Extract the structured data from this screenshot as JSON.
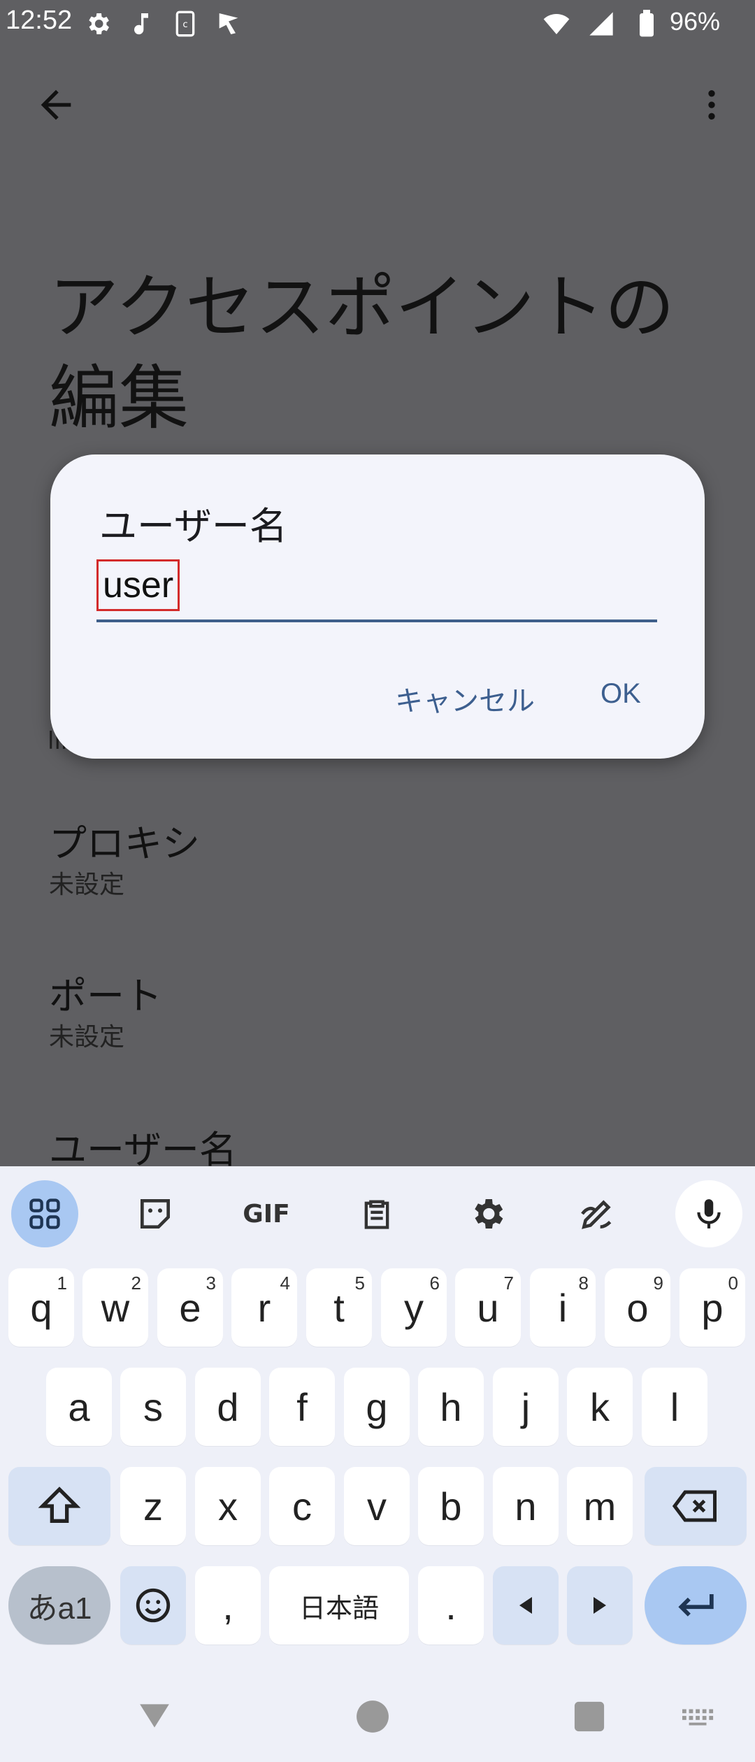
{
  "status_bar": {
    "time": "12:52",
    "battery": "96%"
  },
  "page": {
    "title": "アクセスポイントの編集",
    "title_line1": "アクセスポイントの",
    "title_line2": "編集",
    "prefs": [
      {
        "title": "プロキシ",
        "summary": "未設定"
      },
      {
        "title": "ポート",
        "summary": "未設定"
      },
      {
        "title": "ユーザー名",
        "summary": ""
      }
    ],
    "partial_text": "lii"
  },
  "dialog": {
    "title": "ユーザー名",
    "value": "user",
    "cancel_label": "キャンセル",
    "ok_label": "OK"
  },
  "keyboard": {
    "toolbar": [
      "apps-icon",
      "sticker-icon",
      "gif-icon",
      "clipboard-icon",
      "settings-icon",
      "handwriting-icon",
      "mic-icon"
    ],
    "gif_label": "GIF",
    "row1": [
      {
        "k": "q",
        "h": "1"
      },
      {
        "k": "w",
        "h": "2"
      },
      {
        "k": "e",
        "h": "3"
      },
      {
        "k": "r",
        "h": "4"
      },
      {
        "k": "t",
        "h": "5"
      },
      {
        "k": "y",
        "h": "6"
      },
      {
        "k": "u",
        "h": "7"
      },
      {
        "k": "i",
        "h": "8"
      },
      {
        "k": "o",
        "h": "9"
      },
      {
        "k": "p",
        "h": "0"
      }
    ],
    "row2": [
      "a",
      "s",
      "d",
      "f",
      "g",
      "h",
      "j",
      "k",
      "l"
    ],
    "row3": [
      "z",
      "x",
      "c",
      "v",
      "b",
      "n",
      "m"
    ],
    "lang_key": "あa1",
    "comma": ",",
    "space_label": "日本語",
    "period": "."
  },
  "colors": {
    "accent": "#3d5f8f",
    "dialog_bg": "#f3f4fb",
    "highlight": "#d32b2b"
  }
}
